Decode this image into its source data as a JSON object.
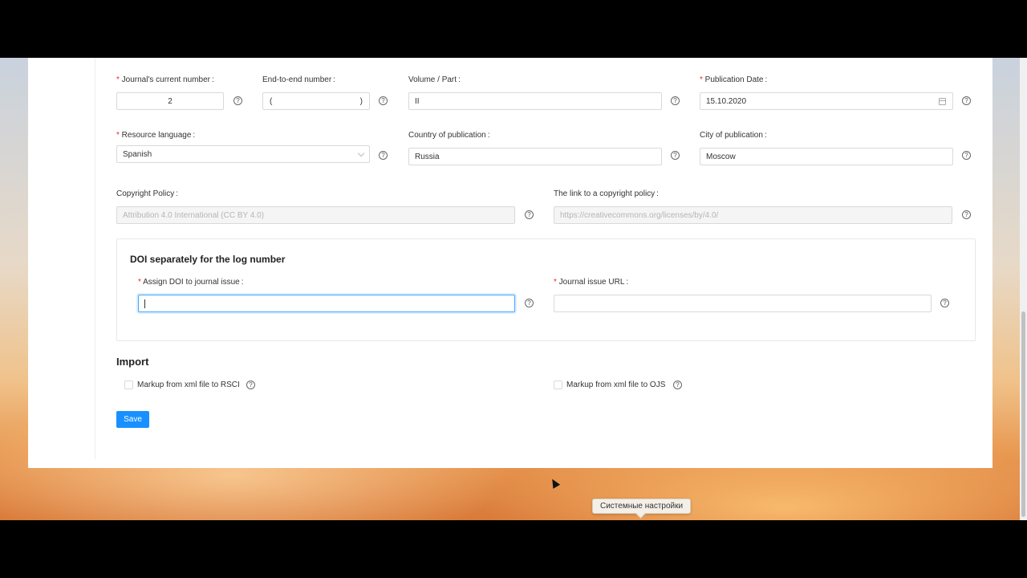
{
  "form": {
    "row1": {
      "current_number": {
        "label": "Journal's current number",
        "value": "2"
      },
      "end_to_end_number": {
        "label": "End-to-end number",
        "value": "",
        "open_paren": "(",
        "close_paren": ")"
      },
      "volume_part": {
        "label": "Volume / Part",
        "value": "II"
      },
      "publication_date": {
        "label": "Publication Date",
        "value": "15.10.2020"
      }
    },
    "row2": {
      "resource_language": {
        "label": "Resource language",
        "value": "Spanish"
      },
      "country": {
        "label": "Country of publication",
        "value": "Russia"
      },
      "city": {
        "label": "City of publication",
        "value": "Moscow"
      }
    },
    "row3": {
      "copyright_policy": {
        "label": "Copyright Policy",
        "value": "Attribution 4.0 International (CC BY 4.0)"
      },
      "copyright_link": {
        "label": "The link to a copyright policy",
        "value": "https://creativecommons.org/licenses/by/4.0/"
      }
    },
    "doi_section": {
      "title": "DOI separately for the log number",
      "assign_doi": {
        "label": "Assign DOI to journal issue",
        "value": ""
      },
      "issue_url": {
        "label": "Journal issue URL",
        "value": ""
      }
    },
    "import_section": {
      "title": "Import",
      "rsci": {
        "label": "Markup from xml file to RSCI",
        "checked": false
      },
      "ojs": {
        "label": "Markup from xml file to OJS",
        "checked": false
      }
    },
    "save_label": "Save",
    "colon": ":",
    "help_glyph": "?"
  },
  "tooltip": "Системные настройки",
  "colors": {
    "primary": "#1890ff",
    "required": "#f5222d"
  }
}
